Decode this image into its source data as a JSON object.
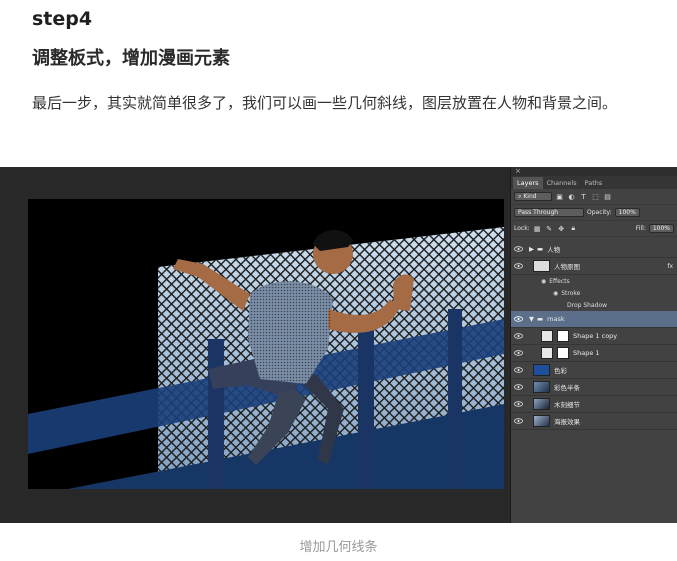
{
  "header": {
    "step": "step4",
    "subtitle": "调整板式，增加漫画元素"
  },
  "paragraph": "最后一步，其实就简单很多了，我们可以画一些几何斜线，图层放置在人物和背景之间。",
  "caption": "增加几何线条",
  "layers_panel": {
    "close": "×",
    "tabs": [
      "Layers",
      "Channels",
      "Paths"
    ],
    "kind_label": "Kind",
    "blend_mode": "Pass Through",
    "opacity_label": "Opacity:",
    "opacity_value": "100%",
    "lock_label": "Lock:",
    "fill_label": "Fill:",
    "fill_value": "100%",
    "layers": [
      {
        "name": "人物",
        "type": "group"
      },
      {
        "name": "人物原图",
        "type": "layer"
      },
      {
        "name": "Effects",
        "type": "effects"
      },
      {
        "name": "Stroke",
        "type": "effect"
      },
      {
        "name": "Drop Shadow",
        "type": "effect"
      },
      {
        "name": "mask",
        "type": "group-open"
      },
      {
        "name": "Shape 1 copy",
        "type": "shape"
      },
      {
        "name": "Shape 1",
        "type": "shape"
      },
      {
        "name": "色彩",
        "type": "fill"
      },
      {
        "name": "彩色半条",
        "type": "layer"
      },
      {
        "name": "木刻细节",
        "type": "layer"
      },
      {
        "name": "海报效果",
        "type": "layer"
      }
    ]
  },
  "colors": {
    "accent_selected": "#5c6f8a",
    "fill_layer": "#1d4f9c",
    "sky": "#9fb8d4",
    "panel_bg": "#424242"
  }
}
